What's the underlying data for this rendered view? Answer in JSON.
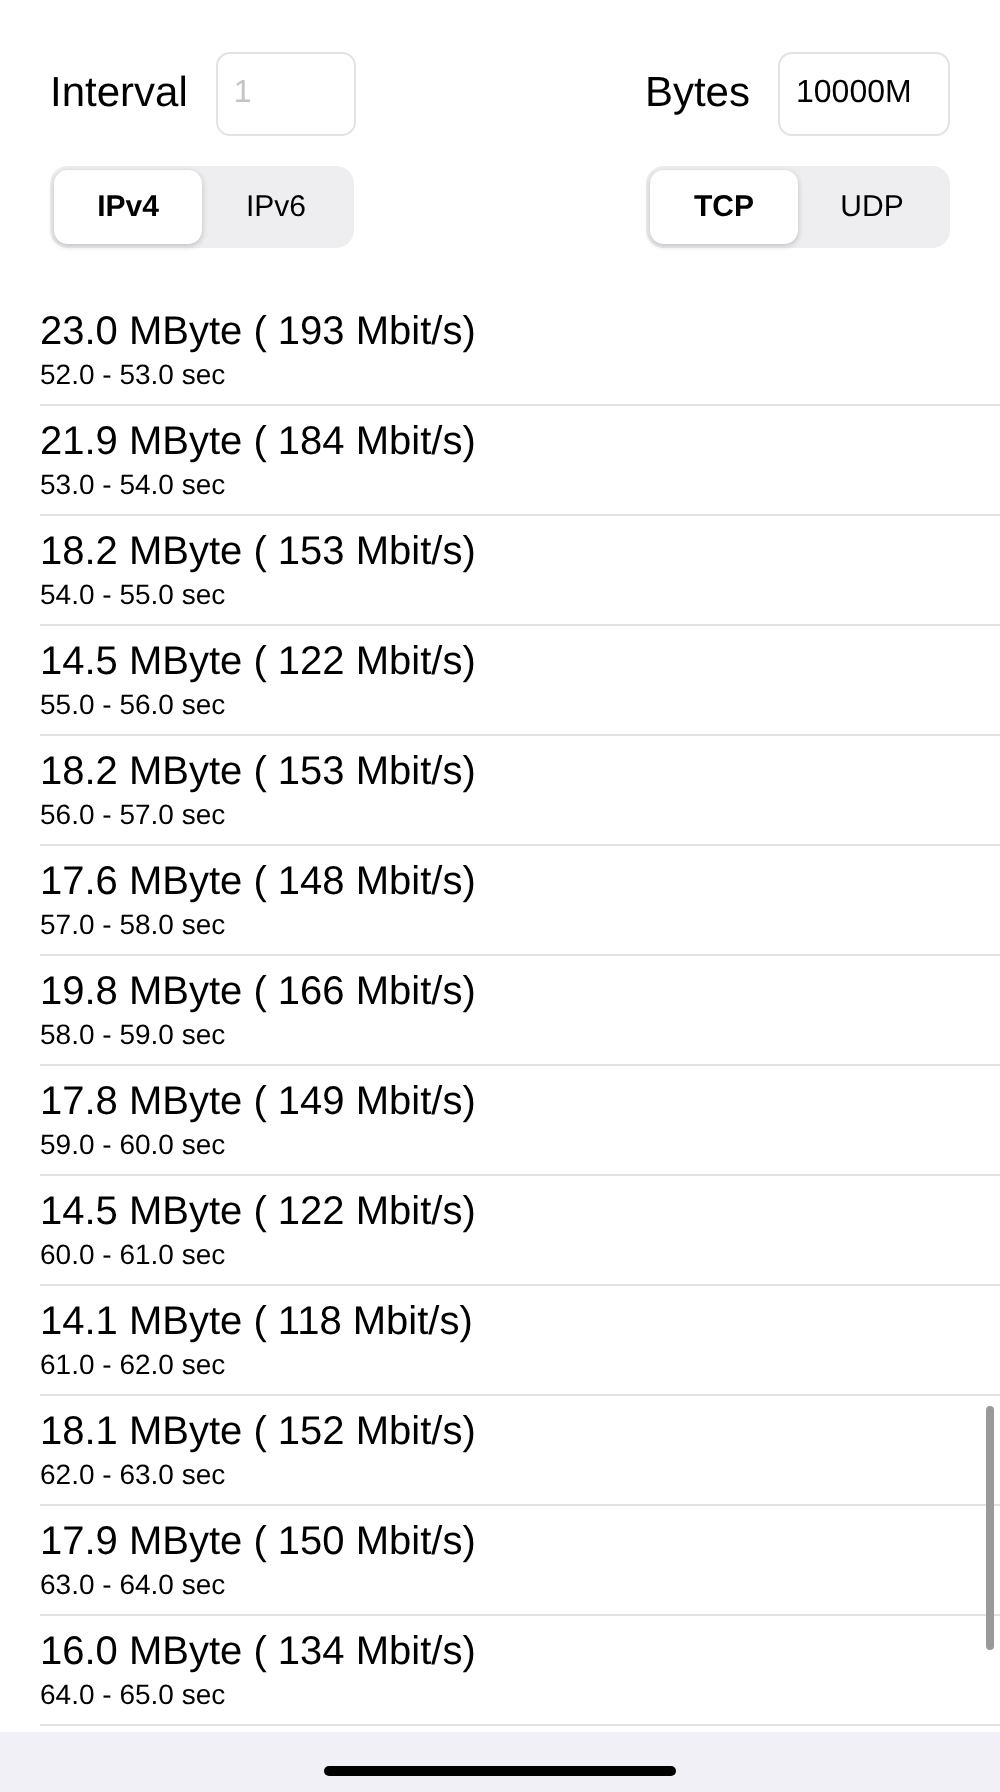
{
  "interval": {
    "label": "Interval",
    "placeholder": "1"
  },
  "bytes": {
    "label": "Bytes",
    "value": "10000M"
  },
  "ip_segments": [
    {
      "label": "IPv4",
      "selected": true
    },
    {
      "label": "IPv6",
      "selected": false
    }
  ],
  "protocol_segments": [
    {
      "label": "TCP",
      "selected": true
    },
    {
      "label": "UDP",
      "selected": false
    }
  ],
  "results": [
    {
      "amount": "23.0 MByte ( 193 Mbit/s)",
      "range": "52.0 - 53.0 sec"
    },
    {
      "amount": "21.9 MByte ( 184 Mbit/s)",
      "range": "53.0 - 54.0 sec"
    },
    {
      "amount": "18.2 MByte ( 153 Mbit/s)",
      "range": "54.0 - 55.0 sec"
    },
    {
      "amount": "14.5 MByte ( 122 Mbit/s)",
      "range": "55.0 - 56.0 sec"
    },
    {
      "amount": "18.2 MByte ( 153 Mbit/s)",
      "range": "56.0 - 57.0 sec"
    },
    {
      "amount": "17.6 MByte ( 148 Mbit/s)",
      "range": "57.0 - 58.0 sec"
    },
    {
      "amount": "19.8 MByte ( 166 Mbit/s)",
      "range": "58.0 - 59.0 sec"
    },
    {
      "amount": "17.8 MByte ( 149 Mbit/s)",
      "range": "59.0 - 60.0 sec"
    },
    {
      "amount": "14.5 MByte ( 122 Mbit/s)",
      "range": "60.0 - 61.0 sec"
    },
    {
      "amount": "14.1 MByte ( 118 Mbit/s)",
      "range": "61.0 - 62.0 sec"
    },
    {
      "amount": "18.1 MByte ( 152 Mbit/s)",
      "range": "62.0 - 63.0 sec"
    },
    {
      "amount": "17.9 MByte ( 150 Mbit/s)",
      "range": "63.0 - 64.0 sec"
    },
    {
      "amount": "16.0 MByte ( 134 Mbit/s)",
      "range": "64.0 - 65.0 sec"
    }
  ]
}
